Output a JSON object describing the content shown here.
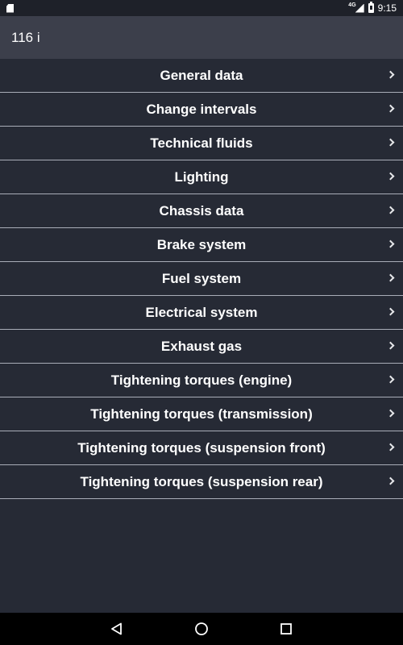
{
  "status_bar": {
    "network": "4G",
    "time": "9:15"
  },
  "app_bar": {
    "title": "116 i"
  },
  "menu": {
    "items": [
      {
        "label": "General data"
      },
      {
        "label": "Change intervals"
      },
      {
        "label": "Technical fluids"
      },
      {
        "label": "Lighting"
      },
      {
        "label": "Chassis data"
      },
      {
        "label": "Brake system"
      },
      {
        "label": "Fuel system"
      },
      {
        "label": "Electrical system"
      },
      {
        "label": "Exhaust gas"
      },
      {
        "label": "Tightening torques (engine)"
      },
      {
        "label": "Tightening torques (transmission)"
      },
      {
        "label": "Tightening torques (suspension front)"
      },
      {
        "label": "Tightening torques (suspension rear)"
      }
    ]
  },
  "icons": {
    "status_left": "sd-card-icon",
    "signal": "signal-icon",
    "battery": "battery-icon",
    "row_chevron": "chevron-right-icon",
    "nav_back": "back-icon",
    "nav_home": "home-icon",
    "nav_recents": "recents-icon"
  },
  "colors": {
    "background": "#262a35",
    "app_bar": "#3c3f4b",
    "divider": "#a9adb8",
    "text": "#ffffff",
    "nav_bar": "#000000"
  }
}
